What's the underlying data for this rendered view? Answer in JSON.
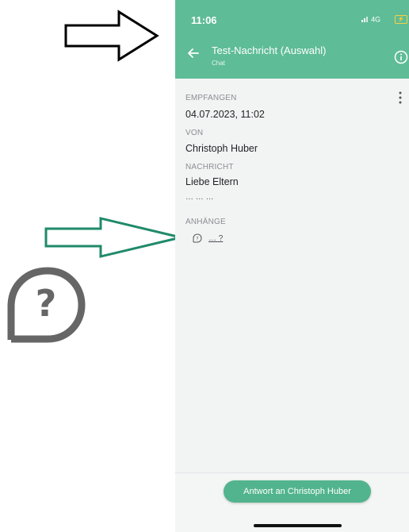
{
  "status": {
    "time": "11:06",
    "network": "4G"
  },
  "header": {
    "title": "Test-Nachricht (Auswahl)",
    "subtitle": "Chat"
  },
  "message": {
    "received_label": "EMPFANGEN",
    "received_value": "04.07.2023, 11:02",
    "from_label": "VON",
    "from_value": "Christoph Huber",
    "message_label": "NACHRICHT",
    "message_value": "Liebe Eltern",
    "message_ellipsis": "… … …",
    "attachments_label": "ANHÄNGE",
    "attachment_text": "… ?"
  },
  "footer": {
    "reply_label": "Antwort an Christoph Huber"
  },
  "colors": {
    "header": "#5ebc97",
    "button": "#52b48e",
    "arrow_green": "#1f8a6a"
  },
  "icons": [
    "back-arrow-icon",
    "info-icon",
    "more-vertical-icon",
    "question-chat-icon",
    "signal-icon",
    "battery-charging-icon"
  ]
}
